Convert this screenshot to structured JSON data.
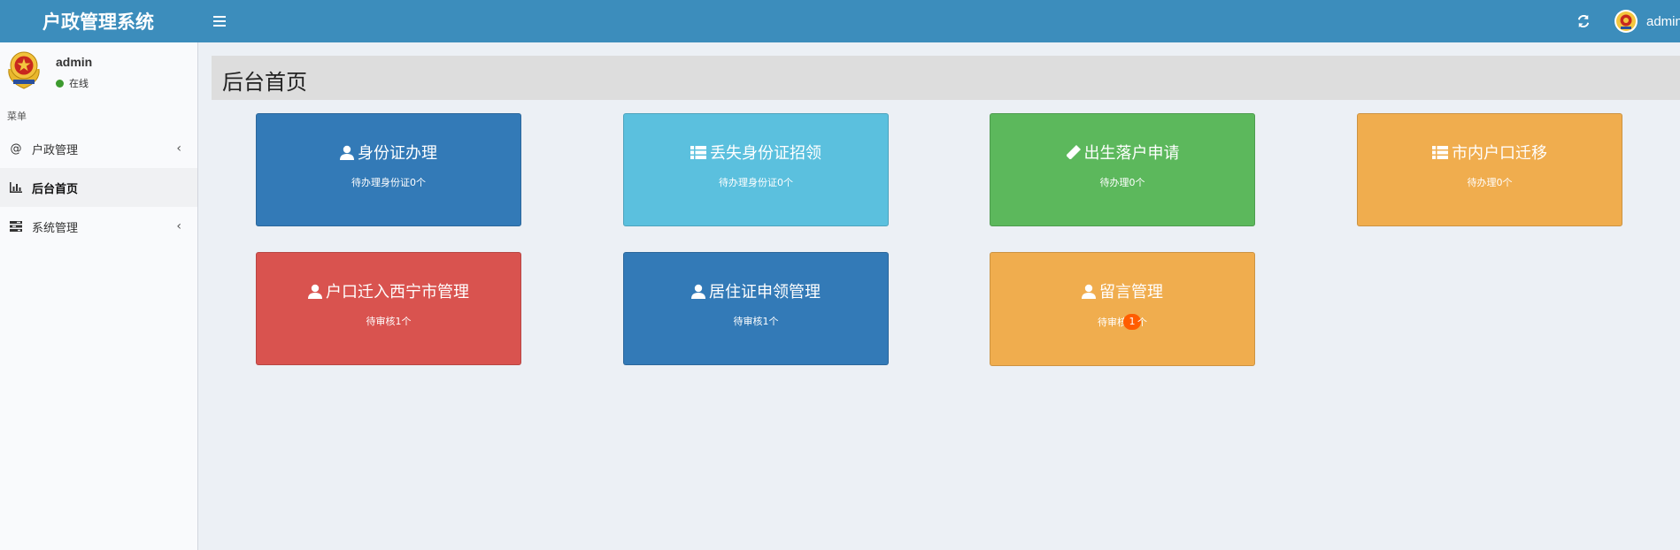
{
  "header": {
    "logo": "户政管理系统",
    "user_name": "admin",
    "color": "#3c8dbc"
  },
  "sidebar": {
    "user": {
      "name": "admin",
      "status": "在线"
    },
    "menu_header": "菜单",
    "items": [
      {
        "label": "户政管理",
        "icon": "at-icon",
        "expandable": true
      },
      {
        "label": "后台首页",
        "icon": "bar-chart-icon",
        "active": true
      },
      {
        "label": "系统管理",
        "icon": "tasks-icon",
        "expandable": true
      }
    ]
  },
  "content": {
    "title": "后台首页",
    "cards": [
      {
        "title": "身份证办理",
        "subtitle": "待办理身份证0个",
        "icon": "user-icon",
        "color": "#337ab7"
      },
      {
        "title": "丢失身份证招领",
        "subtitle": "待办理身份证0个",
        "icon": "list-icon",
        "color": "#5bc0de"
      },
      {
        "title": "出生落户申请",
        "subtitle": "待办理0个",
        "icon": "pencil-icon",
        "color": "#5cb85c"
      },
      {
        "title": "市内户口迁移",
        "subtitle": "待办理0个",
        "icon": "list-icon",
        "color": "#f0ad4e"
      },
      {
        "title": "户口迁入西宁市管理",
        "subtitle": "待审核1个",
        "icon": "user-icon",
        "color": "#d9534f"
      },
      {
        "title": "居住证申领管理",
        "subtitle": "待审核1个",
        "icon": "user-icon",
        "color": "#337ab7"
      },
      {
        "title": "留言管理",
        "subtitle_before": "待审核",
        "badge": "1",
        "subtitle_after": "个",
        "icon": "user-icon",
        "color": "#f0ad4e",
        "badge_color": "#ff5d00"
      }
    ]
  }
}
